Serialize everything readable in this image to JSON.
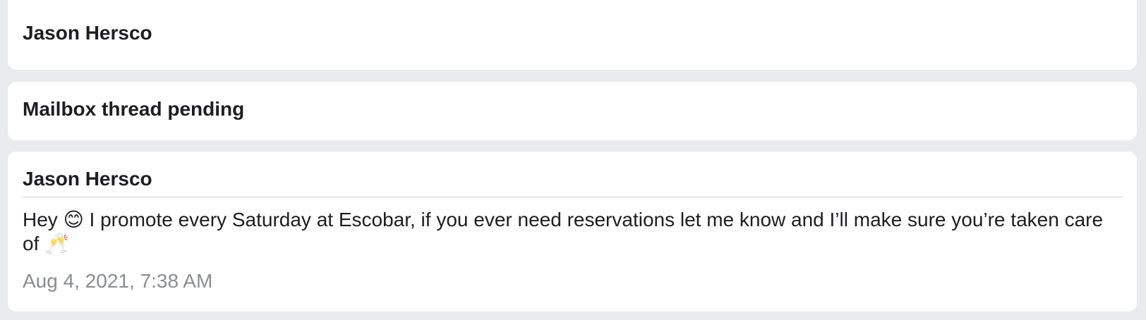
{
  "blocks": [
    {
      "title": "Jason Hersco"
    },
    {
      "title": "Mailbox thread pending"
    },
    {
      "sender": "Jason Hersco",
      "message": "Hey 😊 I promote every Saturday at Escobar, if you ever need reservations let me know and I’ll make sure you’re taken care of 🥂",
      "timestamp": "Aug 4, 2021, 7:38 AM"
    }
  ]
}
